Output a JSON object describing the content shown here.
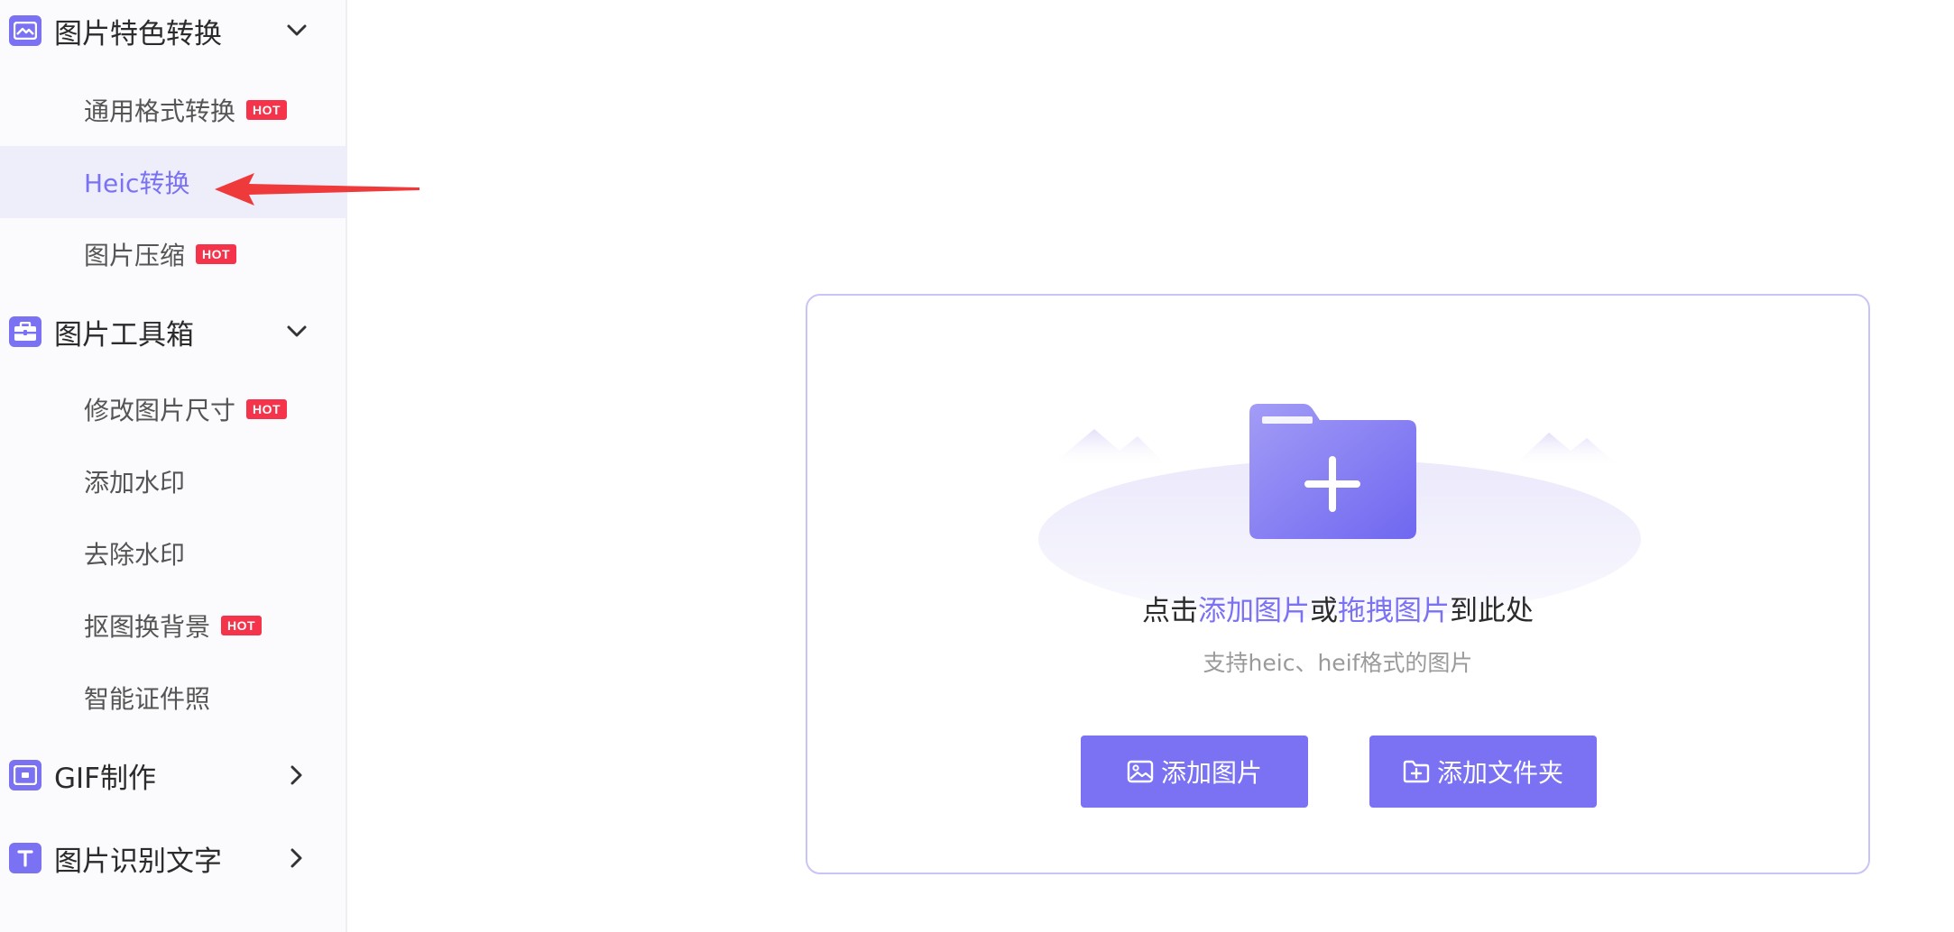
{
  "sidebar": {
    "groups": [
      {
        "title": "图片特色转换",
        "icon": "image-convert-icon",
        "expanded": true,
        "items": [
          {
            "label": "通用格式转换",
            "hot": "HOT"
          },
          {
            "label": "Heic转换",
            "active": true
          },
          {
            "label": "图片压缩",
            "hot": "HOT"
          }
        ]
      },
      {
        "title": "图片工具箱",
        "icon": "toolbox-icon",
        "expanded": true,
        "items": [
          {
            "label": "修改图片尺寸",
            "hot": "HOT"
          },
          {
            "label": "添加水印"
          },
          {
            "label": "去除水印"
          },
          {
            "label": "抠图换背景",
            "hot": "HOT"
          },
          {
            "label": "智能证件照"
          }
        ]
      },
      {
        "title": "GIF制作",
        "icon": "gif-icon",
        "expanded": false
      },
      {
        "title": "图片识别文字",
        "icon": "text-recognition-icon",
        "expanded": false
      }
    ]
  },
  "upload": {
    "prefix": "点击",
    "add_link": "添加图片",
    "or": "或",
    "drag_link": "拖拽图片",
    "suffix": "到此处",
    "hint": "支持heic、heif格式的图片",
    "add_image_button": "添加图片",
    "add_folder_button": "添加文件夹"
  },
  "colors": {
    "accent": "#7b72f3",
    "hot_badge": "#f5344b",
    "active_bg": "#eeedfa"
  }
}
